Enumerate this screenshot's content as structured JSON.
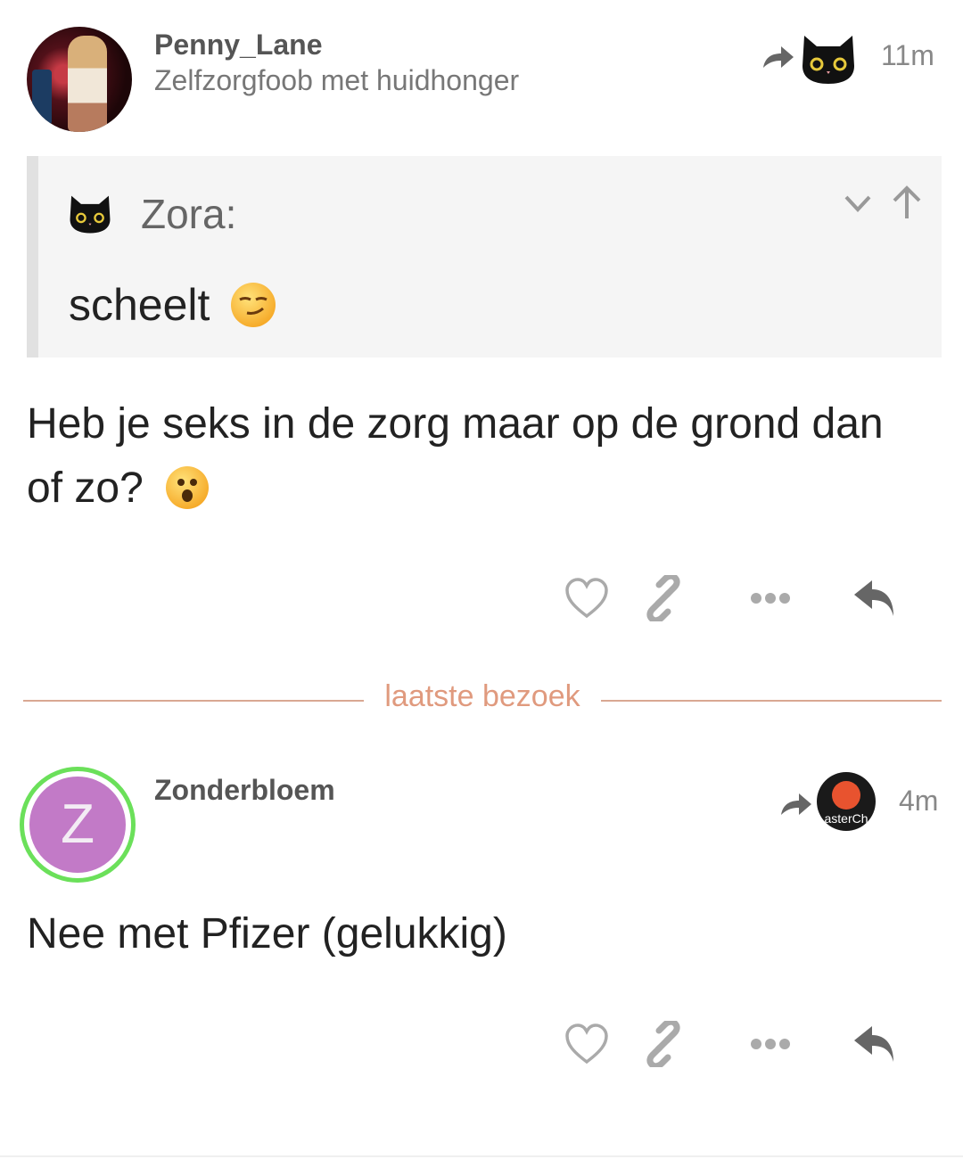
{
  "post1": {
    "username": "Penny_Lane",
    "subtitle": "Zelfzorgfoob met huidhonger",
    "time": "11m",
    "quote": {
      "author": "Zora:",
      "text": "scheelt"
    },
    "body_line1": "Heb je seks in de zorg maar op de grond dan",
    "body_line2": "of zo?"
  },
  "divider": {
    "label": "laatste bezoek"
  },
  "post2": {
    "username": "Zonderbloem",
    "avatar_letter": "Z",
    "reply_badge_text": "asterCh",
    "time": "4m",
    "body": "Nee met Pfizer (gelukkig)"
  },
  "icons": {
    "reply_to": "share-arrow-icon",
    "like": "heart-icon",
    "link": "link-icon",
    "more": "ellipsis-icon",
    "reply": "reply-icon"
  },
  "colors": {
    "divider": "#d9a892",
    "divider_text": "#e09a7e",
    "avatar_z": "#c27ac7",
    "online_ring": "#6be05a"
  }
}
